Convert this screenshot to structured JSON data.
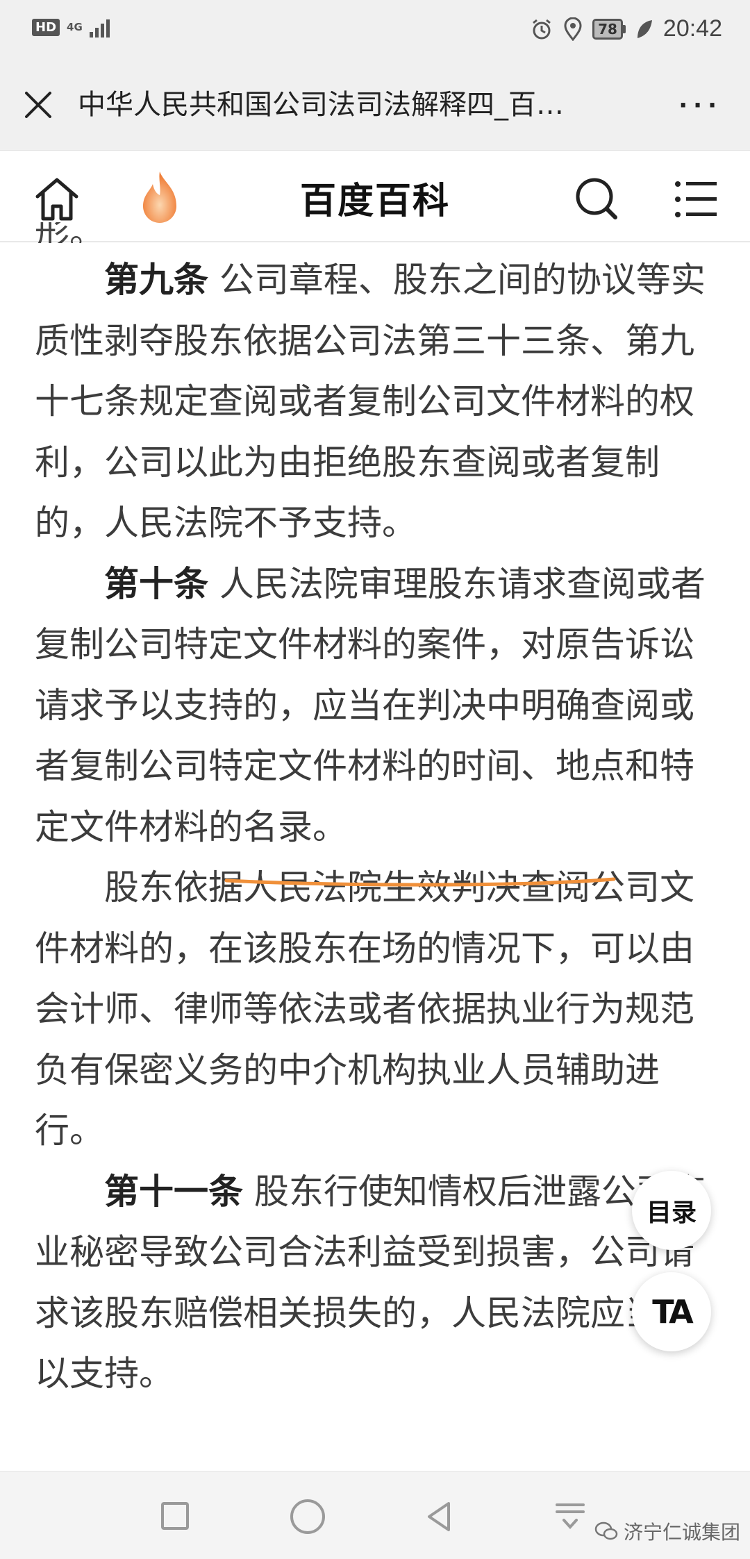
{
  "status_bar": {
    "hd": "HD",
    "network": "4G",
    "battery": "78",
    "time": "20:42",
    "icons": [
      "alarm-icon",
      "location-icon",
      "leaf-icon"
    ]
  },
  "titlebar": {
    "title": "中华人民共和国公司法司法解释四_百…",
    "more": "···"
  },
  "header": {
    "title": "百度百科",
    "icons": [
      "home-icon",
      "flame-icon",
      "search-icon",
      "menu-icon"
    ]
  },
  "article": {
    "cutoff_text": "形。",
    "art9_label": "第九条",
    "art9_text": " 公司章程、股东之间的协议等实质性剥夺股东依据公司法第三十三条、第九十七条规定查阅或者复制公司文件材料的权利，公司以此为由拒绝股东查阅或者复制的，人民法院不予支持。",
    "art10_label": "第十条",
    "art10_text_a": " 人民法院审理股东请求查阅或者复制公司特定文件材料的案件，对原告诉讼请求予以支持的，应当在判决中明确查阅或者复制公司特定文件材料的时间、地点和",
    "art10_text_b": "特定文件材料的名录",
    "art10_text_c": "。",
    "art10_para2": "股东依据人民法院生效判决查阅公司文件材料的，在该股东在场的情况下，可以由会计师、律师等依法或者依据执业行为规范负有保密义务的中介机构执业人员辅助进行。",
    "art11_label": "第十一条",
    "art11_text": " 股东行使知情权后泄露公司商业秘密导致公司合法利益受到损害，公司请求该股东赔偿相关损失的，人民法院应当予以支持。",
    "highlight_color": "#f0903a"
  },
  "floating": {
    "toc": "目录",
    "font": "TA"
  },
  "watermark": {
    "text": "济宁仁诚集团"
  }
}
